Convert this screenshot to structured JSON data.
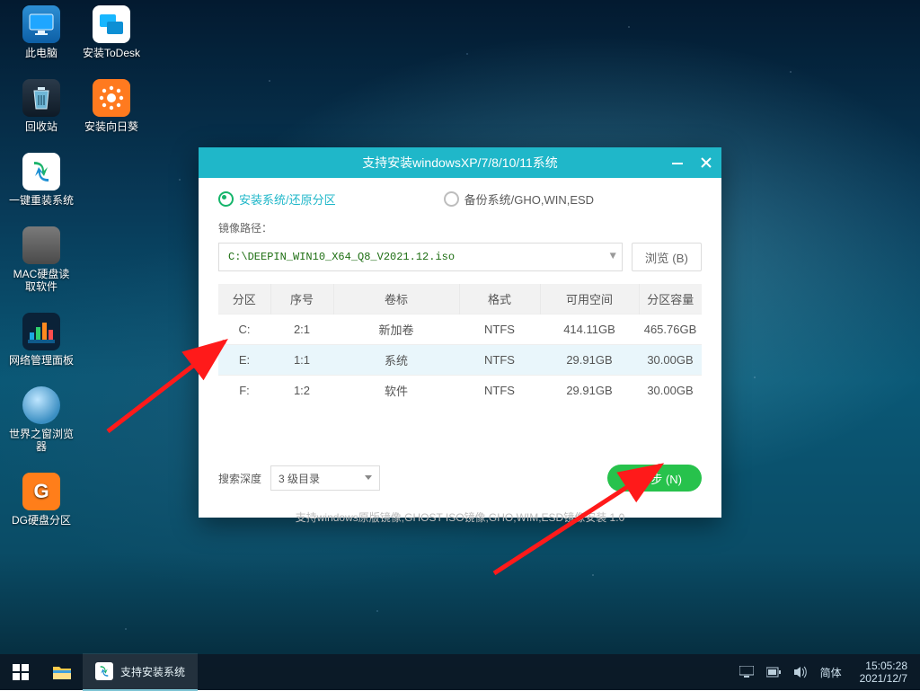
{
  "desktop": {
    "c1": [
      "此电脑",
      "回收站",
      "一键重装系统",
      "MAC硬盘读\n取软件",
      "网络管理面板",
      "世界之窗浏览\n器",
      "DG硬盘分区"
    ],
    "c2": [
      "安装ToDesk",
      "安装向日葵"
    ]
  },
  "window": {
    "title": "支持安装windowsXP/7/8/10/11系统",
    "tab_install": "安装系统/还原分区",
    "tab_backup": "备份系统/GHO,WIN,ESD",
    "path_label": "镜像路径：",
    "path_value": "C:\\DEEPIN_WIN10_X64_Q8_V2021.12.iso",
    "browse": "浏览 (B)",
    "headers": [
      "分区",
      "序号",
      "卷标",
      "格式",
      "可用空间",
      "分区容量"
    ],
    "rows": [
      {
        "d": "C:",
        "n": "2:1",
        "v": "新加卷",
        "f": "NTFS",
        "free": "414.11GB",
        "cap": "465.76GB",
        "sel": false
      },
      {
        "d": "E:",
        "n": "1:1",
        "v": "系统",
        "f": "NTFS",
        "free": "29.91GB",
        "cap": "30.00GB",
        "sel": true
      },
      {
        "d": "F:",
        "n": "1:2",
        "v": "软件",
        "f": "NTFS",
        "free": "29.91GB",
        "cap": "30.00GB",
        "sel": false
      }
    ],
    "depth_label": "搜索深度",
    "depth_value": "3 级目录",
    "next": "下一步 (N)",
    "footer": "支持windows原版镜像,GHOST ISO镜像,GHO,WIM,ESD镜像安装     1.0"
  },
  "taskbar": {
    "task_label": "支持安装系统",
    "ime": "简体",
    "time": "15:05:28",
    "date": "2021/12/7"
  }
}
